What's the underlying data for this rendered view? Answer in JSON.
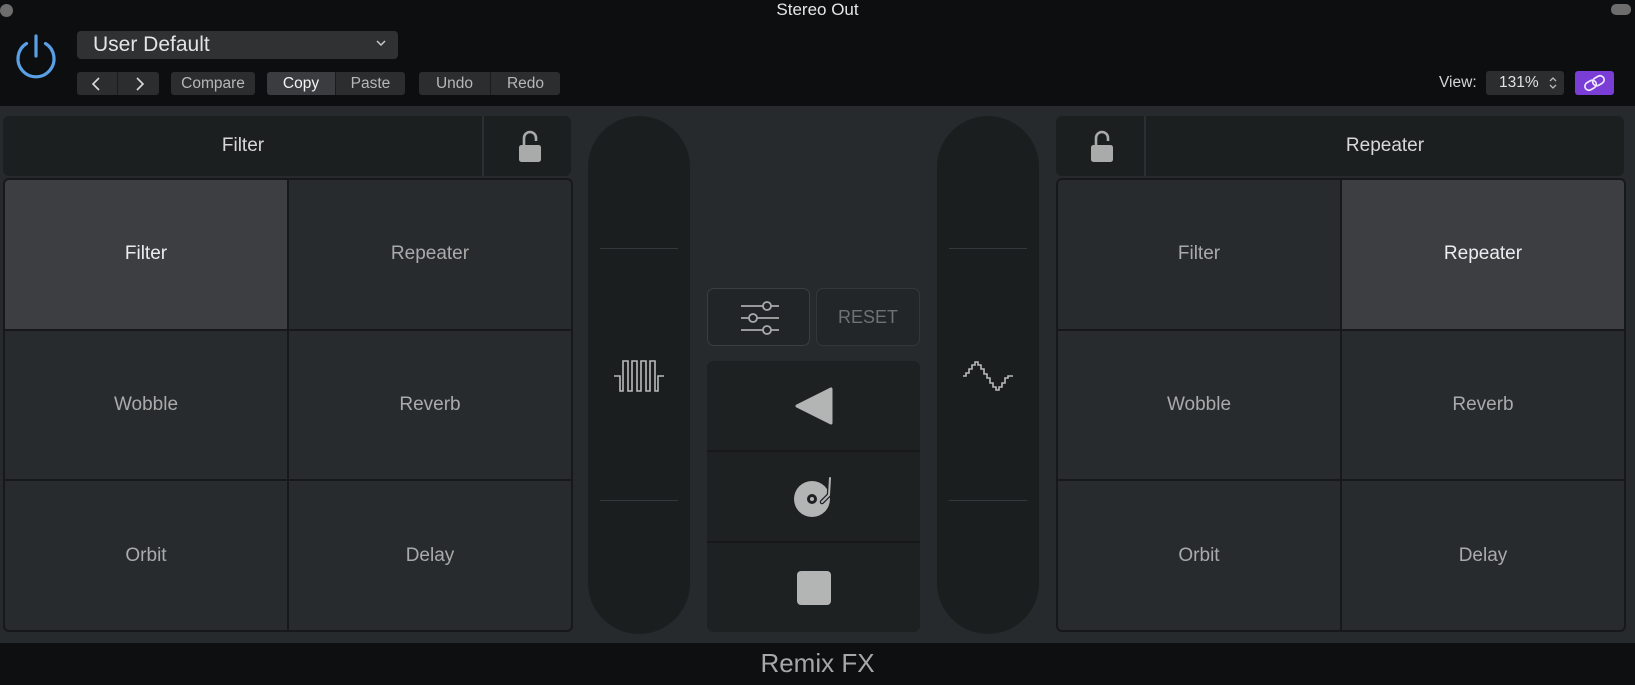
{
  "window": {
    "title": "Stereo Out"
  },
  "header": {
    "preset": "User Default",
    "toolbar": {
      "compare": "Compare",
      "copy": "Copy",
      "paste": "Paste",
      "undo": "Undo",
      "redo": "Redo"
    },
    "view_label": "View:",
    "view_value": "131%",
    "link_color": "#7a3ed6"
  },
  "left_panel": {
    "title": "Filter",
    "pads": [
      "Filter",
      "Repeater",
      "Wobble",
      "Reverb",
      "Orbit",
      "Delay"
    ],
    "selected": "Filter"
  },
  "right_panel": {
    "title": "Repeater",
    "pads": [
      "Filter",
      "Repeater",
      "Wobble",
      "Reverb",
      "Orbit",
      "Delay"
    ],
    "selected": "Repeater"
  },
  "center": {
    "reset_label": "RESET",
    "left_xy_icon": "square-wave-icon",
    "right_xy_icon": "stepped-sine-wave-icon",
    "transport_icons": [
      "reverse-play-icon",
      "turntable-icon",
      "stop-icon"
    ]
  },
  "footer": {
    "title": "Remix FX"
  },
  "colors": {
    "accent": "#5aa0e6",
    "link": "#7a3ed6"
  }
}
